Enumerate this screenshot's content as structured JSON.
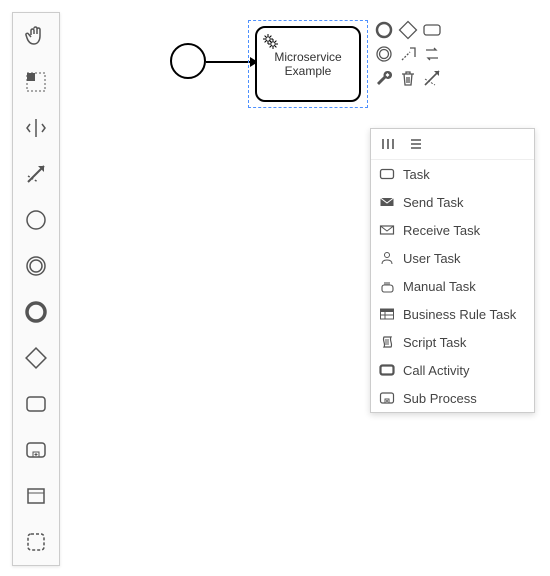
{
  "palette": {
    "items": [
      "hand-tool",
      "lasso-tool",
      "space-tool",
      "global-connect-tool",
      "start-event",
      "intermediate-event",
      "end-event",
      "gateway",
      "task",
      "subprocess-expanded",
      "data-object",
      "group"
    ]
  },
  "diagram": {
    "task_label": "Microservice\nExample"
  },
  "context_pad": {
    "items": [
      "append-end-event",
      "append-gateway",
      "append-task",
      "append-intermediate-event",
      "annotation",
      "replace",
      "wrench",
      "delete",
      "connect"
    ]
  },
  "popup": {
    "items": [
      {
        "key": "task",
        "label": "Task"
      },
      {
        "key": "send-task",
        "label": "Send Task"
      },
      {
        "key": "receive-task",
        "label": "Receive Task"
      },
      {
        "key": "user-task",
        "label": "User Task"
      },
      {
        "key": "manual-task",
        "label": "Manual Task"
      },
      {
        "key": "business-rule",
        "label": "Business Rule Task"
      },
      {
        "key": "script-task",
        "label": "Script Task"
      },
      {
        "key": "call-activity",
        "label": "Call Activity"
      },
      {
        "key": "sub-process",
        "label": "Sub Process"
      }
    ]
  }
}
